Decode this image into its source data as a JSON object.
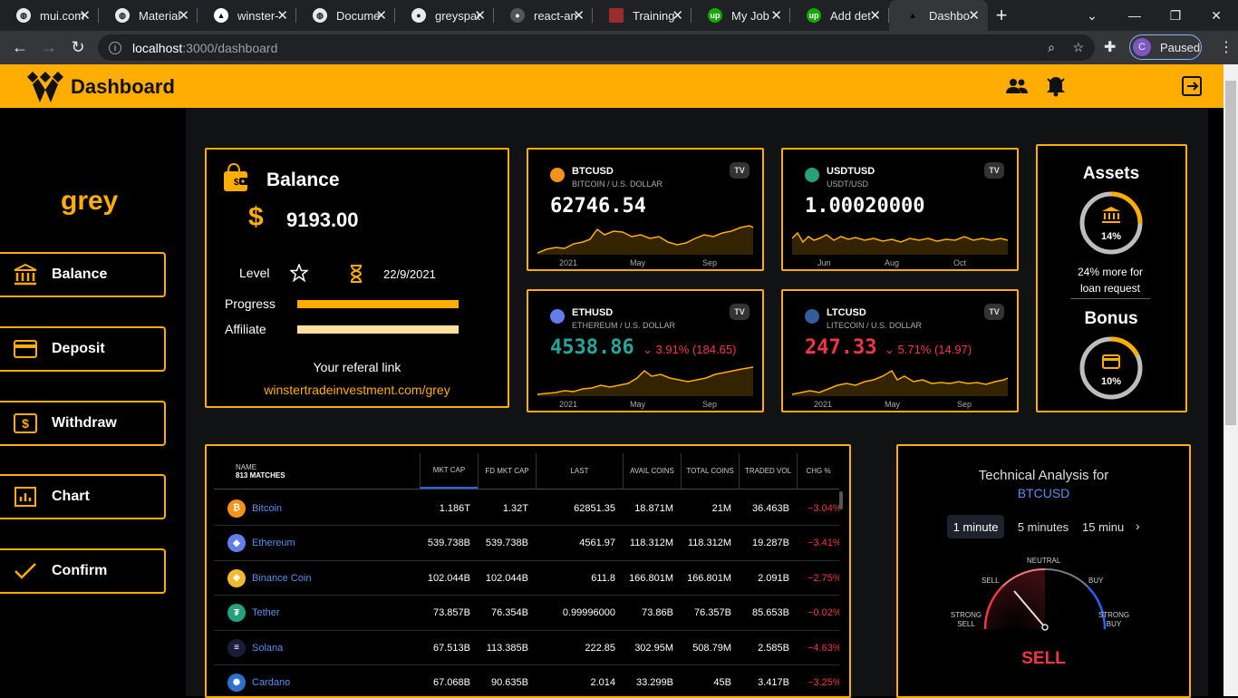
{
  "browser": {
    "tabs": [
      {
        "title": "mui.com",
        "icon": "globe-icon"
      },
      {
        "title": "Material",
        "icon": "globe-icon"
      },
      {
        "title": "winster-",
        "icon": "vercel-icon"
      },
      {
        "title": "Docume",
        "icon": "globe-icon"
      },
      {
        "title": "greyspac",
        "icon": "github-icon"
      },
      {
        "title": "react-an",
        "icon": "github-icon"
      },
      {
        "title": "Training",
        "icon": "training-icon"
      },
      {
        "title": "My Job",
        "icon": "upwork-icon"
      },
      {
        "title": "Add det",
        "icon": "upwork-icon"
      },
      {
        "title": "Dashbo",
        "icon": "vercel-icon"
      }
    ],
    "url_host": "localhost",
    "url_path": ":3000/dashboard",
    "profile_initial": "C",
    "profile_status": "Paused"
  },
  "app": {
    "title": "Dashboard",
    "brand": "grey",
    "accent": "#ffad00"
  },
  "sidebar": {
    "items": [
      {
        "label": "Balance",
        "icon": "bank-icon"
      },
      {
        "label": "Deposit",
        "icon": "card-icon"
      },
      {
        "label": "Withdraw",
        "icon": "dollar-bill-icon"
      },
      {
        "label": "Chart",
        "icon": "bar-chart-icon"
      },
      {
        "label": "Confirm",
        "icon": "check-icon"
      }
    ]
  },
  "balance": {
    "title": "Balance",
    "currency": "$",
    "amount": "9193.00",
    "level_label": "Level",
    "date": "22/9/2021",
    "progress_label": "Progress",
    "progress_value": 1.0,
    "affiliate_label": "Affiliate",
    "affiliate_value": 1.0,
    "referral_title": "Your referal link",
    "referral_link": "winstertradeinvestment.com/grey"
  },
  "tickers": [
    {
      "symbol": "BTCUSD",
      "name": "BITCOIN / U.S. DOLLAR",
      "price": "62746.54",
      "change": "",
      "price_color": "#ffffff",
      "x_labels": [
        "2021",
        "May",
        "Sep"
      ]
    },
    {
      "symbol": "USDTUSD",
      "name": "USDT/USD",
      "price": "1.00020000",
      "change": "",
      "price_color": "#ffffff",
      "x_labels": [
        "Jun",
        "Aug",
        "Oct"
      ]
    },
    {
      "symbol": "ETHUSD",
      "name": "ETHEREUM / U.S. DOLLAR",
      "price": "4538.86",
      "change": "⌄ 3.91% (184.65)",
      "price_color": "#26a69a",
      "x_labels": [
        "2021",
        "May",
        "Sep"
      ]
    },
    {
      "symbol": "LTCUSD",
      "name": "LITECOIN / U.S. DOLLAR",
      "price": "247.33",
      "change": "⌄ 5.71% (14.97)",
      "price_color": "#f23645",
      "x_labels": [
        "2021",
        "May",
        "Sep"
      ]
    }
  ],
  "assets": {
    "title": "Assets",
    "percent": "14%",
    "percent_value": 14,
    "note": "24% more for loan request",
    "bonus_title": "Bonus",
    "bonus_percent": "10%",
    "bonus_value": 10
  },
  "table": {
    "name_header": "NAME",
    "matches": "813 MATCHES",
    "columns": [
      "MKT CAP",
      "FD MKT CAP",
      "LAST",
      "AVAIL COINS",
      "TOTAL COINS",
      "TRADED VOL",
      "CHG %"
    ],
    "rows": [
      {
        "name": "Bitcoin",
        "color": "#f7931a",
        "glyph": "₿",
        "cells": [
          "1.186T",
          "1.32T",
          "62851.35",
          "18.871M",
          "21M",
          "36.463B",
          "−3.04%"
        ]
      },
      {
        "name": "Ethereum",
        "color": "#627eea",
        "glyph": "◆",
        "cells": [
          "539.738B",
          "539.738B",
          "4561.97",
          "118.312M",
          "118.312M",
          "19.287B",
          "−3.41%"
        ]
      },
      {
        "name": "Binance Coin",
        "color": "#f3ba2f",
        "glyph": "◈",
        "cells": [
          "102.044B",
          "102.044B",
          "611.8",
          "166.801M",
          "166.801M",
          "2.091B",
          "−2.75%"
        ]
      },
      {
        "name": "Tether",
        "color": "#26a17b",
        "glyph": "₮",
        "cells": [
          "73.857B",
          "76.354B",
          "0.99996000",
          "73.86B",
          "76.357B",
          "85.653B",
          "−0.02%"
        ]
      },
      {
        "name": "Solana",
        "color": "#1c1c3a",
        "glyph": "≡",
        "cells": [
          "67.513B",
          "113.385B",
          "222.85",
          "302.95M",
          "508.79M",
          "2.585B",
          "−4.63%"
        ]
      },
      {
        "name": "Cardano",
        "color": "#2a71d0",
        "glyph": "✺",
        "cells": [
          "67.068B",
          "90.635B",
          "2.014",
          "33.299B",
          "45B",
          "3.417B",
          "−3.25%"
        ]
      }
    ]
  },
  "technical": {
    "title": "Technical Analysis for",
    "symbol": "BTCUSD",
    "intervals": [
      "1 minute",
      "5 minutes",
      "15 minu"
    ],
    "labels": {
      "neutral": "NEUTRAL",
      "sell": "SELL",
      "buy": "BUY",
      "strong_sell": "STRONG SELL",
      "strong_buy": "STRONG BUY"
    },
    "signal": "SELL",
    "signal_color": "#f23645"
  }
}
